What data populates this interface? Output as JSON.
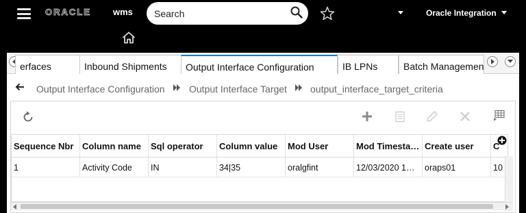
{
  "header": {
    "logo_text": "ORACLE",
    "product": "wms",
    "search_placeholder": "Search",
    "app_name": "Oracle Integration"
  },
  "tabs": [
    {
      "label": "erfaces"
    },
    {
      "label": "Inbound Shipments"
    },
    {
      "label": "Output Interface Configuration",
      "active": true
    },
    {
      "label": "IB LPNs"
    },
    {
      "label": "Batch Management"
    }
  ],
  "breadcrumb": [
    "Output Interface Configuration",
    "Output Interface Target",
    "output_interface_target_criteria"
  ],
  "grid": {
    "columns": [
      "Sequence Nbr",
      "Column name",
      "Sql operator",
      "Column value",
      "Mod User",
      "Mod Timestamp",
      "Create user",
      "C"
    ],
    "rows": [
      [
        "1",
        "Activity Code",
        "IN",
        "34|35",
        "oralgfint",
        "12/03/2020 1…",
        "oraps01",
        "10"
      ]
    ]
  },
  "colors": {
    "header_bg": "#000000",
    "accent": "#0b7fc7",
    "content_bg": "#ffffff"
  },
  "icons": {
    "menu": "hamburger-icon",
    "search": "search-icon",
    "favorite": "star-icon",
    "home": "home-icon",
    "back": "back-arrow-icon",
    "refresh": "refresh-icon",
    "add": "plus-icon",
    "copy": "copy-icon",
    "edit": "pencil-icon",
    "delete": "x-icon",
    "export": "grid-export-icon",
    "add_column": "plus-circle-icon"
  }
}
